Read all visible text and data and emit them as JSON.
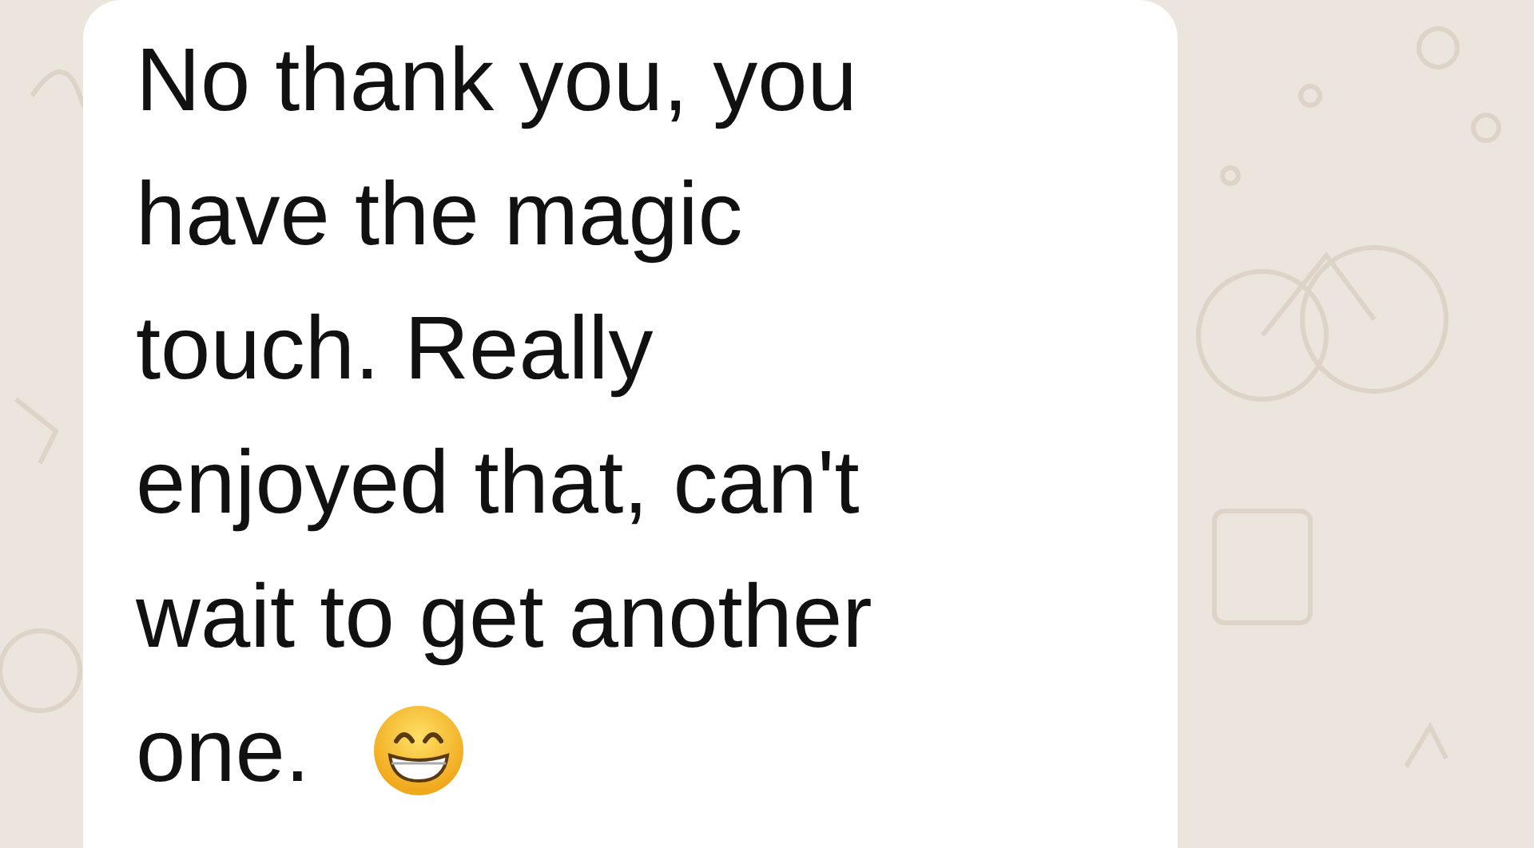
{
  "message": {
    "lines": [
      "No thank you, you",
      "have the magic",
      "touch. Really",
      "enjoyed that, can't",
      "wait to get another",
      "one."
    ]
  }
}
